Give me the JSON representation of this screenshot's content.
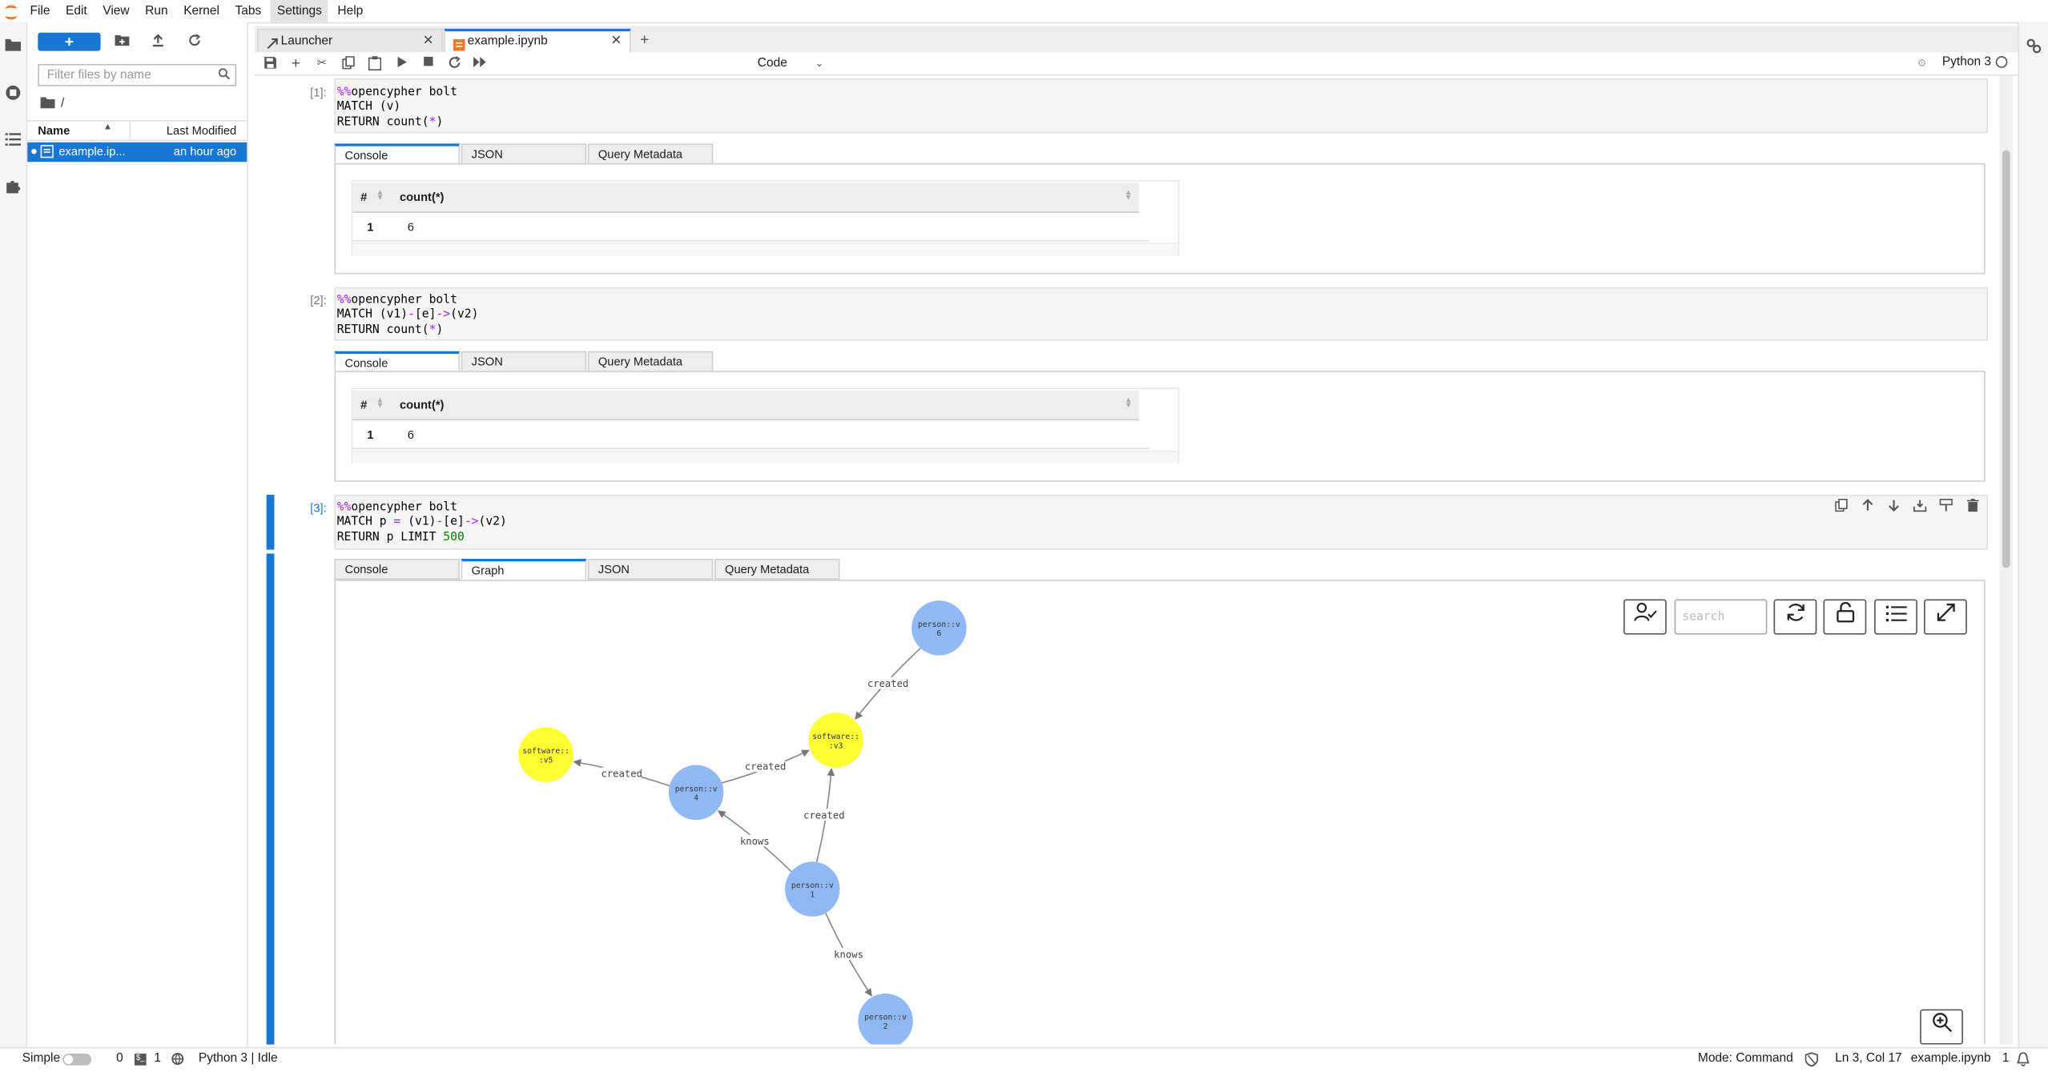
{
  "menubar": {
    "items": [
      {
        "label": "File"
      },
      {
        "label": "Edit"
      },
      {
        "label": "View"
      },
      {
        "label": "Run"
      },
      {
        "label": "Kernel"
      },
      {
        "label": "Tabs"
      },
      {
        "label": "Settings"
      },
      {
        "label": "Help"
      }
    ],
    "active": "Settings"
  },
  "leftbar": {
    "icons": [
      "folder-icon",
      "running-icon",
      "toc-icon",
      "extension-icon"
    ]
  },
  "filebrowser": {
    "new_label": "+",
    "filter_placeholder": "Filter files by name",
    "breadcrumb": "/",
    "columns": {
      "name": "Name",
      "modified": "Last Modified"
    },
    "files": [
      {
        "name": "example.ip...",
        "modified": "an hour ago",
        "selected": true
      }
    ]
  },
  "tabs": [
    {
      "label": "Launcher",
      "active": false
    },
    {
      "label": "example.ipynb",
      "active": true
    }
  ],
  "toolbar": {
    "cell_type": "Code",
    "kernel_name": "Python 3"
  },
  "cells": [
    {
      "prompt": "[1]:",
      "code": [
        [
          {
            "t": "%%",
            "c": "mg"
          },
          {
            "t": "opencypher bolt",
            "c": ""
          }
        ],
        [
          {
            "t": "MATCH (v)",
            "c": ""
          }
        ],
        [
          {
            "t": "RETURN count(",
            "c": ""
          },
          {
            "t": "*",
            "c": "op"
          },
          {
            "t": ")",
            "c": ""
          }
        ]
      ],
      "output_tabs": [
        "Console",
        "JSON",
        "Query Metadata"
      ],
      "table": {
        "headers": [
          "#",
          "count(*)"
        ],
        "rows": [
          [
            "1",
            "6"
          ]
        ]
      }
    },
    {
      "prompt": "[2]:",
      "code": [
        [
          {
            "t": "%%",
            "c": "mg"
          },
          {
            "t": "opencypher bolt",
            "c": ""
          }
        ],
        [
          {
            "t": "MATCH (v1)",
            "c": ""
          },
          {
            "t": "-",
            "c": "op"
          },
          {
            "t": "[e]",
            "c": ""
          },
          {
            "t": "->",
            "c": "op"
          },
          {
            "t": "(v2)",
            "c": ""
          }
        ],
        [
          {
            "t": "RETURN count(",
            "c": ""
          },
          {
            "t": "*",
            "c": "op"
          },
          {
            "t": ")",
            "c": ""
          }
        ]
      ],
      "output_tabs": [
        "Console",
        "JSON",
        "Query Metadata"
      ],
      "table": {
        "headers": [
          "#",
          "count(*)"
        ],
        "rows": [
          [
            "1",
            "6"
          ]
        ]
      }
    },
    {
      "prompt": "[3]:",
      "code": [
        [
          {
            "t": "%%",
            "c": "mg"
          },
          {
            "t": "opencypher bolt",
            "c": ""
          }
        ],
        [
          {
            "t": "MATCH p ",
            "c": ""
          },
          {
            "t": "=",
            "c": "op"
          },
          {
            "t": " (v1)",
            "c": ""
          },
          {
            "t": "-",
            "c": "op"
          },
          {
            "t": "[e]",
            "c": ""
          },
          {
            "t": "->",
            "c": "op"
          },
          {
            "t": "(v2)",
            "c": ""
          }
        ],
        [
          {
            "t": "RETURN p LIMIT ",
            "c": ""
          },
          {
            "t": "500",
            "c": "num"
          }
        ]
      ],
      "output_tabs": [
        "Console",
        "Graph",
        "JSON",
        "Query Metadata"
      ]
    }
  ],
  "graph": {
    "search_placeholder": "search",
    "node_colors": {
      "person": "#8fb8f5",
      "software": "#ffff33"
    },
    "nodes": [
      {
        "id": "v6",
        "label": [
          "person::v",
          "6"
        ],
        "type": "person"
      },
      {
        "id": "v3",
        "label": [
          "software::",
          ":v3"
        ],
        "type": "software"
      },
      {
        "id": "v5",
        "label": [
          "software::",
          ":v5"
        ],
        "type": "software"
      },
      {
        "id": "v4",
        "label": [
          "person::v",
          "4"
        ],
        "type": "person"
      },
      {
        "id": "v1",
        "label": [
          "person::v",
          "1"
        ],
        "type": "person"
      },
      {
        "id": "v2",
        "label": [
          "person::v",
          "2"
        ],
        "type": "person"
      }
    ],
    "edges": [
      {
        "from": "v6",
        "to": "v3",
        "label": "created"
      },
      {
        "from": "v4",
        "to": "v3",
        "label": "created"
      },
      {
        "from": "v4",
        "to": "v5",
        "label": "created"
      },
      {
        "from": "v1",
        "to": "v3",
        "label": "created"
      },
      {
        "from": "v1",
        "to": "v4",
        "label": "knows"
      },
      {
        "from": "v1",
        "to": "v2",
        "label": "knows"
      }
    ]
  },
  "statusbar": {
    "mode_label": "Simple",
    "terminals": "0",
    "kernels": "1",
    "kernel_status": "Python 3 | Idle",
    "mode": "Mode: Command",
    "position": "Ln 3, Col 17",
    "filename": "example.ipynb",
    "notifications": "1"
  }
}
